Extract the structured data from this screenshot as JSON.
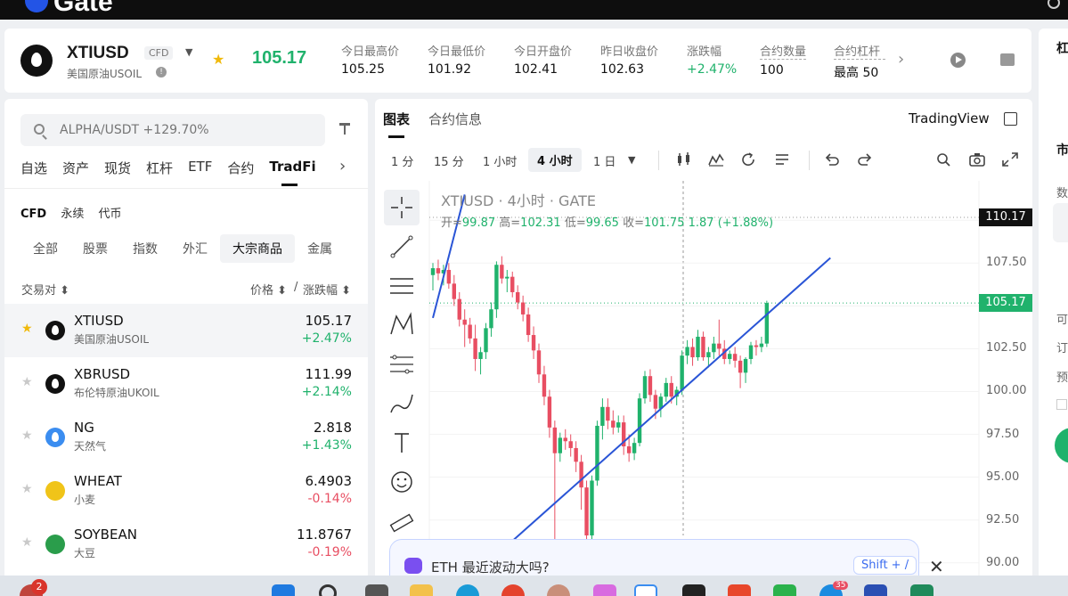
{
  "topbar": {
    "logo": "Gate"
  },
  "header": {
    "symbol": "XTIUSD",
    "badge": "CFD",
    "subtitle": "美国原油USOIL",
    "last_price": "105.17",
    "stats": [
      {
        "label": "今日最高价",
        "value": "105.25",
        "up": false
      },
      {
        "label": "今日最低价",
        "value": "101.92",
        "up": false
      },
      {
        "label": "今日开盘价",
        "value": "102.41",
        "up": false
      },
      {
        "label": "昨日收盘价",
        "value": "102.63",
        "up": false
      },
      {
        "label": "涨跌幅",
        "value": "+2.47%",
        "up": true
      },
      {
        "label": "合约数量",
        "value": "100",
        "up": false
      },
      {
        "label": "合约杠杆",
        "value": "最高 50",
        "up": false
      }
    ]
  },
  "left": {
    "search_placeholder": "ALPHA/USDT +129.70%",
    "tabs": [
      "自选",
      "资产",
      "现货",
      "杠杆",
      "ETF",
      "合约",
      "TradFi"
    ],
    "active_tab": "TradFi",
    "subtabs": [
      "CFD",
      "永续",
      "代币"
    ],
    "categories": [
      "全部",
      "股票",
      "指数",
      "外汇",
      "大宗商品",
      "金属"
    ],
    "columns": {
      "pair": "交易对 ⬍",
      "price": "价格 ⬍",
      "slash": "/",
      "change": "涨跌幅 ⬍"
    },
    "rows": [
      {
        "name": "XTIUSD",
        "sub": "美国原油USOIL",
        "price": "105.17",
        "change": "+2.47%",
        "dir": "up",
        "starred": true,
        "icon_color": "#111111",
        "icon": "oil-drop-icon"
      },
      {
        "name": "XBRUSD",
        "sub": "布伦特原油UKOIL",
        "price": "111.99",
        "change": "+2.14%",
        "dir": "up",
        "starred": false,
        "icon_color": "#111111",
        "icon": "oil-drop-icon"
      },
      {
        "name": "NG",
        "sub": "天然气",
        "price": "2.818",
        "change": "+1.43%",
        "dir": "up",
        "starred": false,
        "icon_color": "#3b8df0",
        "icon": "flame-icon"
      },
      {
        "name": "WHEAT",
        "sub": "小麦",
        "price": "6.4903",
        "change": "-0.14%",
        "dir": "down",
        "starred": false,
        "icon_color": "#f0c419",
        "icon": "wheat-icon"
      },
      {
        "name": "SOYBEAN",
        "sub": "大豆",
        "price": "11.8767",
        "change": "-0.19%",
        "dir": "down",
        "starred": false,
        "icon_color": "#2a9d4b",
        "icon": "soybean-icon"
      }
    ]
  },
  "center": {
    "tabs": [
      "图表",
      "合约信息"
    ],
    "tradingview_label": "TradingView",
    "timeframes": [
      "1 分",
      "15 分",
      "1 小时",
      "4 小时",
      "1 日"
    ],
    "active_timeframe": "4 小时",
    "chart_title": "XTIUSD · 4小时 · GATE",
    "ohlc": {
      "open_label": "开=",
      "open": "99.87",
      "high_label": "高=",
      "high": "102.31",
      "low_label": "低=",
      "low": "99.65",
      "close_label": "收=",
      "close": "101.75",
      "change": "1.87 (+1.88%)"
    }
  },
  "chart_data": {
    "type": "candlestick",
    "title": "XTIUSD · 4小时 · GATE",
    "y_ticks": [
      110.0,
      107.5,
      105.0,
      102.5,
      100.0,
      97.5,
      95.0,
      92.5,
      90.0
    ],
    "y_tick_labels": [
      "",
      "107.50",
      "",
      "102.50",
      "100.00",
      "97.50",
      "95.00",
      "92.50",
      "90.00"
    ],
    "ylim": [
      89.0,
      112.3
    ],
    "price_tags": [
      {
        "value": 110.17,
        "label": "110.17",
        "bg": "#111111",
        "fg": "#ffffff"
      },
      {
        "value": 105.17,
        "label": "105.17",
        "bg": "#20b26c",
        "fg": "#ffffff"
      }
    ],
    "candles": [
      [
        106.8,
        107.5,
        105.9,
        107.2
      ],
      [
        107.2,
        107.7,
        106.5,
        106.9
      ],
      [
        106.9,
        107.4,
        106.2,
        107.1
      ],
      [
        107.1,
        107.5,
        106.0,
        106.3
      ],
      [
        106.3,
        106.8,
        105.0,
        105.4
      ],
      [
        105.4,
        105.8,
        103.8,
        104.2
      ],
      [
        104.2,
        104.8,
        102.6,
        103.9
      ],
      [
        103.9,
        104.3,
        102.8,
        103.1
      ],
      [
        103.1,
        103.9,
        101.2,
        101.9
      ],
      [
        101.9,
        102.6,
        101.0,
        102.3
      ],
      [
        102.3,
        104.0,
        101.9,
        103.7
      ],
      [
        103.7,
        105.2,
        103.2,
        104.8
      ],
      [
        104.8,
        107.6,
        104.3,
        107.4
      ],
      [
        107.4,
        107.9,
        106.3,
        106.6
      ],
      [
        106.6,
        107.1,
        105.8,
        106.7
      ],
      [
        106.7,
        107.0,
        105.5,
        105.8
      ],
      [
        105.8,
        106.2,
        104.8,
        105.2
      ],
      [
        105.2,
        105.6,
        104.1,
        104.5
      ],
      [
        104.5,
        104.9,
        102.9,
        103.3
      ],
      [
        103.3,
        103.8,
        101.9,
        102.4
      ],
      [
        102.4,
        102.8,
        100.5,
        101.0
      ],
      [
        101.0,
        101.5,
        99.2,
        99.7
      ],
      [
        99.7,
        100.1,
        97.3,
        97.9
      ],
      [
        97.9,
        98.3,
        90.2,
        96.4
      ],
      [
        96.4,
        97.6,
        95.9,
        97.3
      ],
      [
        97.3,
        97.8,
        96.6,
        97.1
      ],
      [
        97.1,
        97.5,
        96.2,
        96.7
      ],
      [
        96.7,
        97.1,
        95.3,
        95.9
      ],
      [
        95.9,
        96.3,
        93.1,
        94.4
      ],
      [
        94.4,
        94.8,
        91.1,
        91.6
      ],
      [
        91.6,
        95.1,
        91.3,
        94.8
      ],
      [
        94.8,
        98.3,
        94.5,
        98.0
      ],
      [
        98.0,
        99.6,
        97.2,
        99.1
      ],
      [
        99.1,
        99.6,
        97.8,
        98.3
      ],
      [
        98.3,
        98.9,
        97.5,
        97.9
      ],
      [
        97.9,
        98.6,
        97.6,
        98.2
      ],
      [
        98.2,
        98.6,
        96.3,
        96.8
      ],
      [
        96.8,
        97.5,
        95.9,
        96.4
      ],
      [
        96.4,
        97.3,
        96.0,
        97.0
      ],
      [
        97.0,
        99.9,
        96.8,
        99.6
      ],
      [
        99.6,
        101.2,
        99.3,
        100.9
      ],
      [
        100.9,
        101.3,
        99.4,
        99.8
      ],
      [
        99.8,
        100.1,
        98.4,
        99.0
      ],
      [
        99.0,
        99.9,
        98.5,
        99.7
      ],
      [
        99.7,
        100.8,
        99.4,
        100.5
      ],
      [
        100.5,
        100.9,
        99.3,
        99.7
      ],
      [
        99.7,
        100.3,
        99.2,
        100.1
      ],
      [
        100.1,
        102.4,
        99.8,
        102.1
      ],
      [
        102.1,
        103.0,
        101.6,
        102.6
      ],
      [
        102.6,
        103.1,
        101.5,
        102.0
      ],
      [
        102.0,
        103.6,
        101.8,
        103.2
      ],
      [
        103.2,
        103.5,
        101.8,
        102.0
      ],
      [
        102.0,
        102.6,
        101.4,
        102.3
      ],
      [
        102.3,
        103.2,
        101.9,
        102.8
      ],
      [
        102.8,
        104.2,
        102.1,
        102.5
      ],
      [
        102.5,
        103.0,
        101.6,
        101.9
      ],
      [
        101.9,
        102.4,
        101.6,
        102.2
      ],
      [
        102.2,
        102.6,
        101.4,
        101.8
      ],
      [
        101.8,
        102.1,
        100.2,
        101.1
      ],
      [
        101.1,
        102.0,
        100.5,
        101.9
      ],
      [
        101.9,
        102.9,
        101.6,
        102.7
      ],
      [
        102.7,
        103.0,
        102.1,
        102.6
      ],
      [
        102.6,
        103.2,
        102.3,
        102.8
      ],
      [
        102.8,
        105.3,
        102.6,
        105.17
      ]
    ],
    "trendlines": [
      {
        "from": [
          0,
          104.3
        ],
        "to": [
          6,
          111.5
        ]
      },
      {
        "from": [
          6,
          88.8
        ],
        "to": [
          75,
          107.8
        ]
      }
    ]
  },
  "popup": {
    "text": "ETH 最近波动大吗?",
    "shortcut": "Shift + /"
  },
  "right_panel": {
    "items": [
      "杠",
      "市",
      "数",
      "可",
      "订",
      "预"
    ]
  },
  "taskbar": {
    "notification_count": "2",
    "mail_count": "35"
  }
}
